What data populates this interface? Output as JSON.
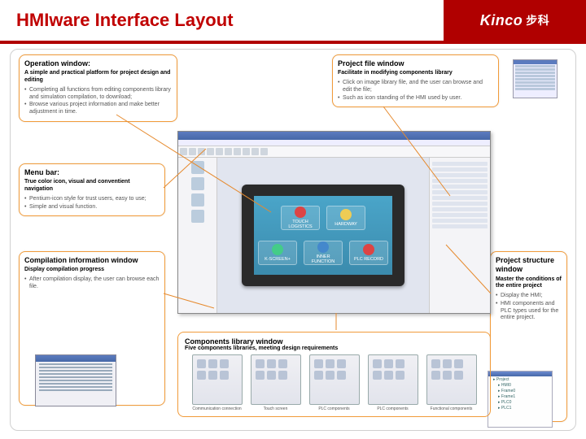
{
  "page_title": "HMIware Interface Layout",
  "brand": {
    "name": "Kinco",
    "cn": "步科"
  },
  "callouts": {
    "operation": {
      "title": "Operation window:",
      "subtitle": "A simple and practical platform for project design and editing",
      "bullets": [
        "Completing all functions from editing components library and simulation compilation, to download;",
        "Browse various project information and make better adjustment in time."
      ]
    },
    "project_file": {
      "title": "Project file window",
      "subtitle": "Facilitate in modifying components library",
      "bullets": [
        "Click on image library file, and the user can browse and edit the file;",
        "Such as icon standing of the HMI used by user."
      ]
    },
    "menu_bar": {
      "title": "Menu bar:",
      "subtitle": "True color icon, visual and conventient navigation",
      "bullets": [
        "Pentium-icon style for trust users, easy to use;",
        "Simple and visual function."
      ]
    },
    "compilation": {
      "title": "Compilation information window",
      "subtitle": "Display compilation progress",
      "bullets": [
        "After compilation display, the user can browse each file."
      ]
    },
    "components_lib": {
      "title": "Components library window",
      "subtitle": "Five components libraries, meeting design requirements"
    },
    "project_structure": {
      "title": "Project structure window",
      "subtitle": "Master the conditions of the entire project",
      "bullets": [
        "Display the HMI;",
        "HMI components and PLC types used for the entire project."
      ]
    }
  },
  "hmi": {
    "btn1": "K-SCREEN+",
    "btn2": "TOUCH LOGISTICS",
    "btn3": "HARDWAY",
    "btn4": "INNER FUNCTION",
    "btn5": "PLC RECORD"
  },
  "components": {
    "c1": "Communication connection",
    "c2": "Touch screen",
    "c3": "PLC components",
    "c4": "PLC components",
    "c5": "Functional components"
  }
}
